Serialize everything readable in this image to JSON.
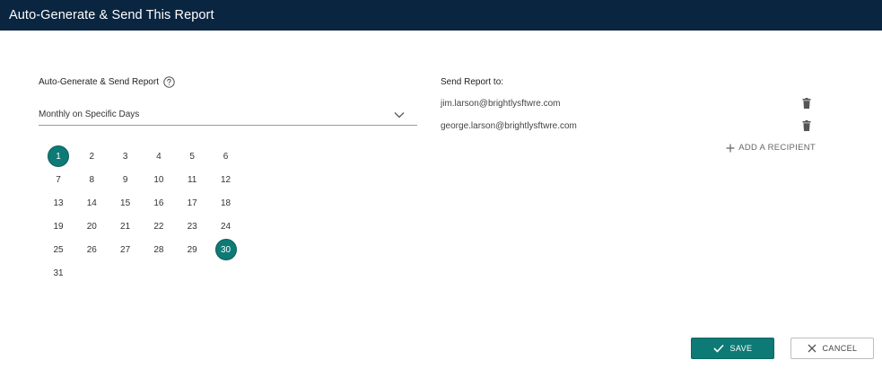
{
  "header": {
    "title": "Auto-Generate & Send This Report"
  },
  "schedule": {
    "label": "Auto-Generate & Send Report",
    "help_icon": "question-circle-icon",
    "selected_option": "Monthly on Specific Days"
  },
  "calendar": {
    "days": [
      "1",
      "2",
      "3",
      "4",
      "5",
      "6",
      "7",
      "8",
      "9",
      "10",
      "11",
      "12",
      "13",
      "14",
      "15",
      "16",
      "17",
      "18",
      "19",
      "20",
      "21",
      "22",
      "23",
      "24",
      "25",
      "26",
      "27",
      "28",
      "29",
      "30",
      "31"
    ],
    "selected_days": [
      "1",
      "30"
    ]
  },
  "recipients": {
    "label": "Send Report to:",
    "items": [
      {
        "email": "jim.larson@brightlysftwre.com"
      },
      {
        "email": "george.larson@brightlysftwre.com"
      }
    ],
    "add_label": "ADD A RECIPIENT"
  },
  "actions": {
    "save_label": "SAVE",
    "cancel_label": "CANCEL"
  },
  "colors": {
    "header_bg": "#0a2540",
    "accent": "#0e7a76"
  }
}
